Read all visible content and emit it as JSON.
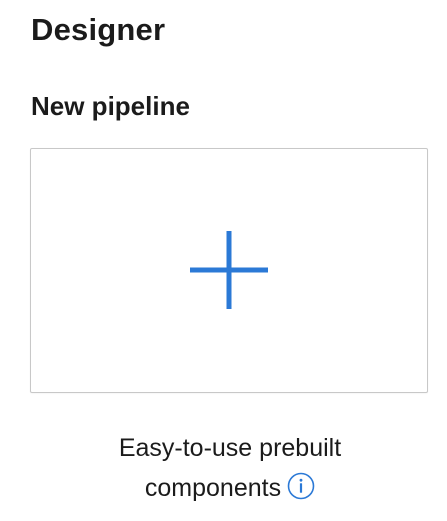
{
  "header": {
    "title": "Designer"
  },
  "new_pipeline": {
    "section_title": "New pipeline",
    "tile_icon": "plus-icon",
    "accent_color": "#2b79d6"
  },
  "caption": {
    "line1": "Easy-to-use prebuilt",
    "line2": "components",
    "info_icon": "info-icon"
  }
}
